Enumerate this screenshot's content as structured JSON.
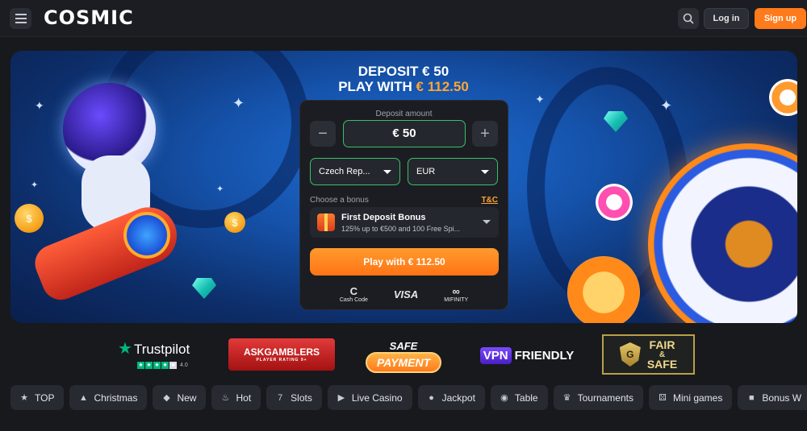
{
  "header": {
    "logo_text": "COSMIC",
    "login_label": "Log in",
    "signup_label": "Sign up",
    "menu_icon": "hamburger-icon",
    "search_icon": "search-icon"
  },
  "hero": {
    "title_line1": "DEPOSIT € 50",
    "title_line2_prefix": "PLAY WITH ",
    "title_line2_amount": "€ 112.50"
  },
  "deposit_form": {
    "amount_label": "Deposit amount",
    "amount_value": "€ 50",
    "minus_symbol": "−",
    "plus_symbol": "+",
    "country_value": "Czech Rep...",
    "currency_value": "EUR",
    "bonus_label": "Choose a bonus",
    "tnc_label": "T&C",
    "bonus_title": "First Deposit Bonus",
    "bonus_description": "125% up to €500 and 100 Free Spi...",
    "play_button_label": "Play with € 112.50",
    "payment_methods": {
      "cashcode_top": "C",
      "cashcode_bottom": "Cash Code",
      "visa": "VISA",
      "mifinity_top": "∞",
      "mifinity_bottom": "MIFINITY"
    }
  },
  "trust_badges": {
    "trustpilot_name": "Trustpilot",
    "trustpilot_score": "4.0",
    "askgamblers_title": "ASKGAMBLERS",
    "askgamblers_sub": "PLAYER RATING 9+",
    "safe_payment_top": "SAFE",
    "safe_payment_bottom": "PAYMENT",
    "vpn_v": "VPN",
    "vpn_rest": "FRIENDLY",
    "fair_line1": "FAIR",
    "fair_line2": "&",
    "fair_line3": "SAFE",
    "fair_shield": "G"
  },
  "categories": [
    {
      "label": "TOP",
      "icon": "star-icon",
      "glyph": "★"
    },
    {
      "label": "Christmas",
      "icon": "tree-icon",
      "glyph": "▲"
    },
    {
      "label": "New",
      "icon": "bell-icon",
      "glyph": "◆"
    },
    {
      "label": "Hot",
      "icon": "flame-icon",
      "glyph": "♨"
    },
    {
      "label": "Slots",
      "icon": "seven-icon",
      "glyph": "7"
    },
    {
      "label": "Live Casino",
      "icon": "play-icon",
      "glyph": "▶"
    },
    {
      "label": "Jackpot",
      "icon": "coins-icon",
      "glyph": "●"
    },
    {
      "label": "Table",
      "icon": "chip-icon",
      "glyph": "◉"
    },
    {
      "label": "Tournaments",
      "icon": "trophy-icon",
      "glyph": "♛"
    },
    {
      "label": "Mini games",
      "icon": "dice-icon",
      "glyph": "⚄"
    },
    {
      "label": "Bonus W",
      "icon": "gift-icon",
      "glyph": "■"
    }
  ]
}
